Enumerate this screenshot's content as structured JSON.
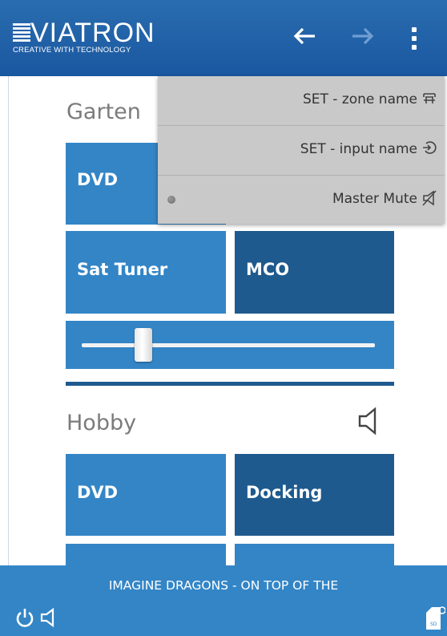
{
  "header": {
    "logo_text": "VIATRON",
    "logo_tagline": "CREATIVE WITH TECHNOLOGY",
    "back_icon": "arrow-left",
    "forward_icon": "arrow-right",
    "menu_icon": "kebab-menu"
  },
  "zones": [
    {
      "name": "Garten",
      "tiles": [
        {
          "label": "DVD",
          "active": false
        },
        {
          "label": "Sat Tuner",
          "active": false
        },
        {
          "label": "MCO",
          "active": true
        }
      ],
      "volume": 0.21
    },
    {
      "name": "Hobby",
      "speaker_icon": "speaker-icon",
      "tiles": [
        {
          "label": "DVD",
          "active": false
        },
        {
          "label": "Docking",
          "active": true
        }
      ]
    }
  ],
  "overflow_menu": {
    "items": [
      {
        "label": "SET - zone name",
        "icon": "zone-name-icon"
      },
      {
        "label": "SET - input name",
        "icon": "input-name-icon"
      },
      {
        "label": "Master Mute",
        "icon": "mute-icon",
        "radio": true
      }
    ]
  },
  "footer": {
    "now_playing": "IMAGINE DRAGONS - ON TOP OF THE",
    "icons": [
      "power-icon",
      "speaker-icon",
      "sd-card-icon"
    ]
  },
  "colors": {
    "header": "#1a57a0",
    "tile_light": "#3385c6",
    "tile_dark": "#1e5a8e",
    "menu_bg": "#c9c9c9",
    "footer": "#3385c6"
  }
}
